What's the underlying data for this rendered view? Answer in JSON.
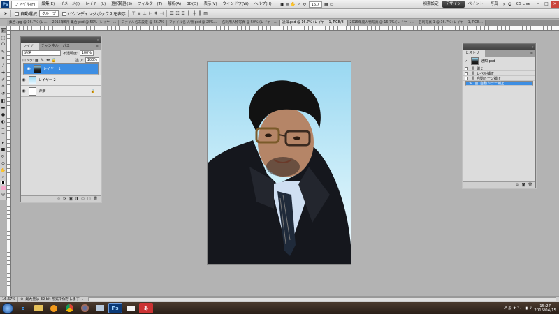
{
  "menubar": {
    "logo": "Ps",
    "items": [
      "ファイル(F)",
      "編集(E)",
      "イメージ(I)",
      "レイヤー(L)",
      "選択範囲(S)",
      "フィルター(T)",
      "解析(A)",
      "3D(D)",
      "表示(V)",
      "ウィンドウ(W)",
      "ヘルプ(H)"
    ],
    "zoom": "16.7",
    "workspaces": [
      "初期設定",
      "デザイン",
      "ペイント",
      "写真"
    ],
    "cs_live": "CS Live",
    "win_controls": [
      "–",
      "□",
      "×"
    ]
  },
  "options": {
    "auto_select_label": "自動選択",
    "auto_select_value": "グループ",
    "bbox_label": "バウンディングボックスを表示"
  },
  "tabs": [
    "集合.jpg @ 16.7% (レ…",
    "2015年6月 集合.psd @ 50% (レイヤー…",
    "ファイル名未設定 @ 66.7%",
    "ファイル名 人物.psd @ 25%…",
    "名刺用人物写真 @ 50% (レイヤー…",
    "通知.psd @ 16.7% (レイヤー 1, RGB/8)",
    "2015年度人物写真 @ 16.7% (レイヤー…",
    "名刺写真 1 @ 16.7% (レイヤー 1, RGB…"
  ],
  "layers_panel": {
    "tabs": [
      "レイヤー",
      "チャンネル",
      "パス"
    ],
    "blend_mode": "通常",
    "opacity_label": "不透明度:",
    "opacity_value": "100%",
    "lock_label": "ロック:",
    "fill_label": "塗り:",
    "fill_value": "100%",
    "layers": [
      {
        "name": "レイヤー 1",
        "selected": true
      },
      {
        "name": "レイヤー 2",
        "selected": false
      },
      {
        "name": "背景",
        "selected": false
      }
    ],
    "footer_icons": [
      "link-icon",
      "fx-icon",
      "mask-icon",
      "adjust-icon",
      "group-icon",
      "new-layer-icon",
      "trash-icon"
    ]
  },
  "history_panel": {
    "tab": "ヒストリー",
    "snapshot": "通知.psd",
    "items": [
      {
        "name": "開く",
        "selected": false
      },
      {
        "name": "レベル補正",
        "selected": false
      },
      {
        "name": "自動トーン補正",
        "selected": false
      },
      {
        "name": "自動カラー補正",
        "selected": true
      }
    ]
  },
  "status": {
    "zoom": "16.67%",
    "info": "最大量は 32 bit 形式で保存します"
  },
  "taskbar": {
    "apps": [
      {
        "icon": "ie-icon",
        "label": "e"
      },
      {
        "icon": "folder-icon",
        "label": ""
      },
      {
        "icon": "media-icon",
        "label": ""
      },
      {
        "icon": "chrome-icon",
        "label": ""
      },
      {
        "icon": "firefox-icon",
        "label": ""
      },
      {
        "icon": "explorer-icon",
        "label": ""
      },
      {
        "icon": "photoshop-icon",
        "label": "Ps"
      },
      {
        "icon": "mail-icon",
        "label": ""
      },
      {
        "icon": "ime-icon",
        "label": "あ"
      }
    ],
    "tray_text": "A 般 ❖ ? 、",
    "time": "15:27",
    "date": "2015/04/15"
  },
  "colors": {
    "selected": "#3d8ee3",
    "canvas_sky": "#9ad8f2",
    "bg_swatch": "#f4a6c9"
  }
}
